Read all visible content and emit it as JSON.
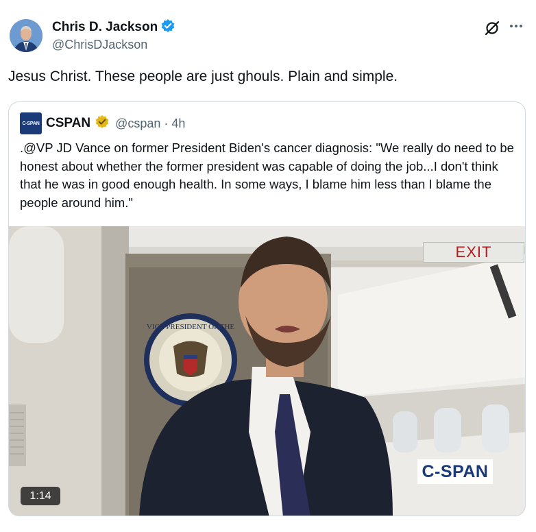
{
  "author": {
    "display_name": "Chris D. Jackson",
    "handle": "@ChrisDJackson",
    "verified": true,
    "verified_color": "#1d9bf0"
  },
  "tweet": {
    "text": "Jesus Christ. These people are just ghouls. Plain and simple."
  },
  "quoted": {
    "avatar_text": "C-SPAN",
    "name": "CSPAN",
    "verified_color": "#e2b719",
    "handle_time": "@cspan · 4h",
    "text": ".@VP JD Vance on former President Biden's cancer diagnosis: \"We really do need to be honest about whether the former president was capable of doing the job...I don't think that he was in good enough health. In some ways, I blame him less than I blame the people around him.\""
  },
  "video": {
    "duration": "1:14",
    "watermark": "C-SPAN",
    "exit_sign": "EXIT",
    "seal_text": "VICE PRESIDENT OF THE"
  },
  "icons": {
    "more": "more-icon",
    "grok": "grok-icon",
    "verified": "verified-badge-icon"
  }
}
